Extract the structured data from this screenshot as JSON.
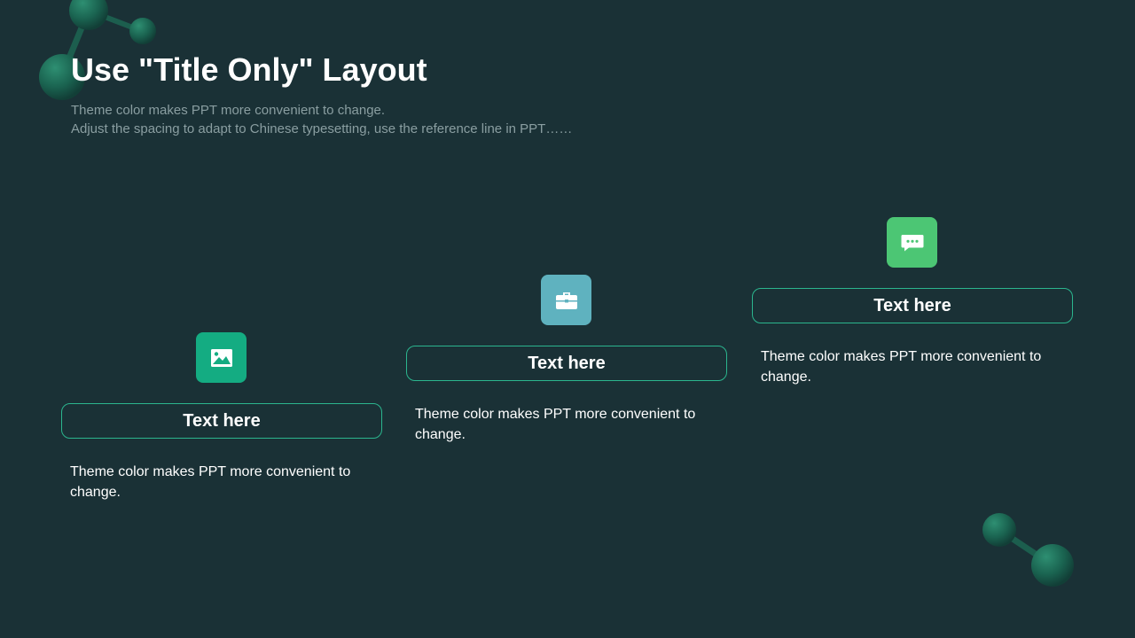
{
  "slide": {
    "title": "Use \"Title Only\" Layout",
    "subtitle_lines": [
      "Theme color makes PPT more convenient to change.",
      "Adjust the spacing to adapt to Chinese typesetting, use the reference line in PPT……"
    ]
  },
  "cards": [
    {
      "icon": "image-icon",
      "icon_color": "#14ac82",
      "label": "Text here",
      "description": "Theme color makes PPT more convenient to change."
    },
    {
      "icon": "briefcase-icon",
      "icon_color": "#5fb2bf",
      "label": "Text here",
      "description": "Theme color makes PPT more convenient to change."
    },
    {
      "icon": "chat-bubble-icon",
      "icon_color": "#4cc674",
      "label": "Text here",
      "description": "Theme color makes PPT more convenient to change."
    }
  ],
  "colors": {
    "background": "#1a3136",
    "accent_border": "#2bb58e",
    "molecule": "#1c6b55"
  }
}
